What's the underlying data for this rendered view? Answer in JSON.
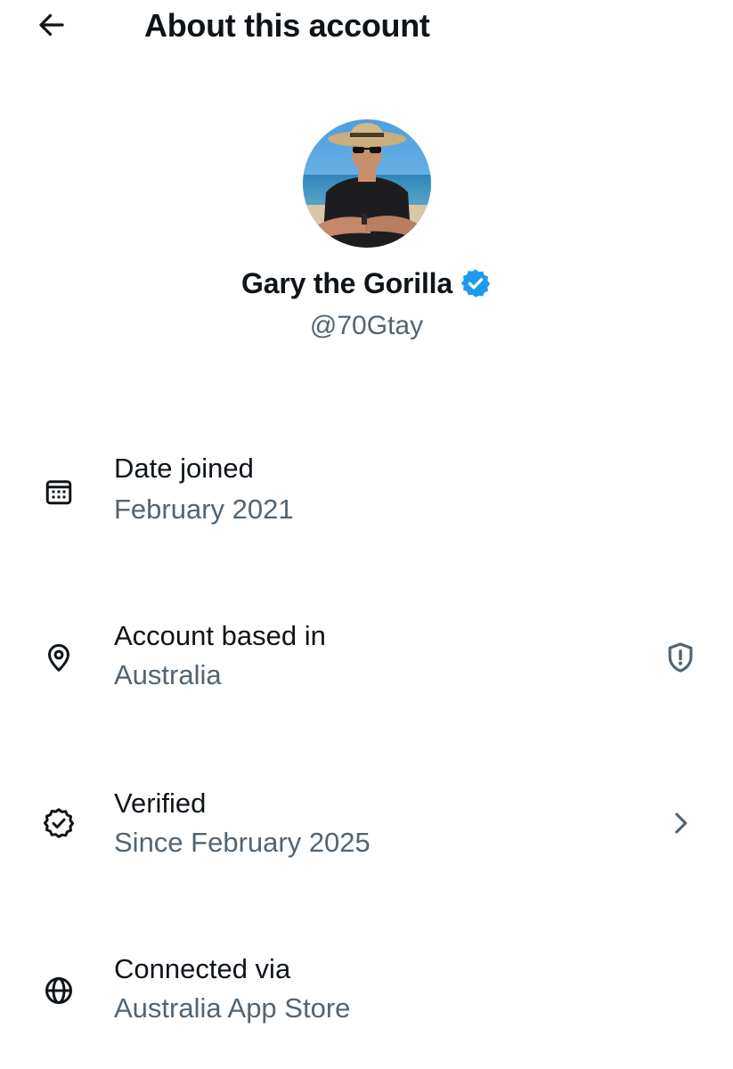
{
  "header": {
    "title": "About this account",
    "back_icon": "arrow-left-icon"
  },
  "profile": {
    "display_name": "Gary the Gorilla",
    "handle": "@70Gtay",
    "verified": true,
    "verified_color": "#1d9bf0",
    "avatar_icon": "profile-photo"
  },
  "details": [
    {
      "icon": "calendar-icon",
      "label": "Date joined",
      "value": "February 2021"
    },
    {
      "icon": "location-pin-icon",
      "label": "Account based in",
      "value": "Australia",
      "trailing_icon": "shield-alert-icon"
    },
    {
      "icon": "verified-check-icon",
      "label": "Verified",
      "value": "Since February 2025",
      "trailing_icon": "chevron-right-icon"
    },
    {
      "icon": "globe-icon",
      "label": "Connected via",
      "value": "Australia App Store"
    }
  ],
  "colors": {
    "primary_text": "#0f1419",
    "secondary_text": "#536471",
    "accent": "#1d9bf0"
  }
}
